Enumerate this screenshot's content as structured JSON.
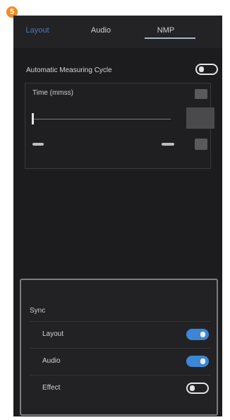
{
  "badge": "5",
  "tabs": [
    {
      "label": "Layout",
      "active": false
    },
    {
      "label": "Audio",
      "active": false
    },
    {
      "label": "NMP",
      "active": true
    }
  ],
  "auto_measuring": {
    "label": "Automatic Measuring Cycle",
    "enabled": false
  },
  "time": {
    "label": "Time (mmss)"
  },
  "sync": {
    "title": "Sync",
    "items": [
      {
        "label": "Layout",
        "enabled": true
      },
      {
        "label": "Audio",
        "enabled": true
      },
      {
        "label": "Effect",
        "enabled": false
      }
    ]
  },
  "colors": {
    "accent": "#3d86d6",
    "badge": "#f08a24",
    "panel_bg": "#1c1c1e"
  }
}
